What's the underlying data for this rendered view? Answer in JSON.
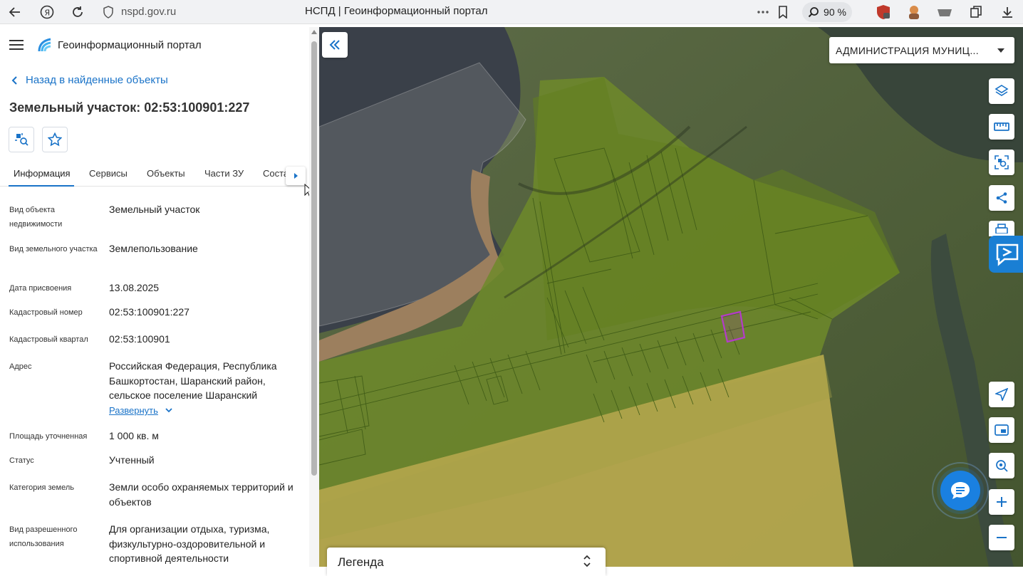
{
  "browser": {
    "url": "nspd.gov.ru",
    "tab_title": "НСПД | Геоинформационный портал",
    "zoom": "90 %"
  },
  "header": {
    "portal_title": "Геоинформационный портал"
  },
  "nav": {
    "back_label": "Назад в найденные объекты"
  },
  "object": {
    "title": "Земельный участок: 02:53:100901:227"
  },
  "tabs": [
    {
      "label": "Информация"
    },
    {
      "label": "Сервисы"
    },
    {
      "label": "Объекты"
    },
    {
      "label": "Части ЗУ"
    },
    {
      "label": "Соста"
    }
  ],
  "properties": [
    {
      "label": "Вид объекта недвижимости",
      "value": "Земельный участок"
    },
    {
      "label": "Вид земельного участка",
      "value": "Землепользование"
    },
    {
      "label": "Дата присвоения",
      "value": "13.08.2025"
    },
    {
      "label": "Кадастровый номер",
      "value": "02:53:100901:227"
    },
    {
      "label": "Кадастровый квартал",
      "value": "02:53:100901"
    },
    {
      "label": "Адрес",
      "value": "Российская Федерация, Республика Башкортостан, Шаранский район, сельское поселение Шаранский"
    },
    {
      "label": "Площадь уточненная",
      "value": "1 000 кв. м"
    },
    {
      "label": "Статус",
      "value": "Учтенный"
    },
    {
      "label": "Категория земель",
      "value": "Земли особо охраняемых территорий и объектов"
    },
    {
      "label": "Вид разрешенного использования",
      "value": "Для организации отдыха, туризма, физкультурно-оздоровительной и спортивной деятельности"
    }
  ],
  "expand_label": "Развернуть",
  "map": {
    "layer_select": "АДМИНИСТРАЦИЯ МУНИЦ...",
    "legend_title": "Легенда"
  },
  "icons": {
    "tools": [
      "layers-icon",
      "ruler-icon",
      "select-area-icon",
      "share-icon",
      "print-icon",
      "locate-icon",
      "minimap-icon",
      "geo-search-icon",
      "zoom-in-icon",
      "zoom-out-icon"
    ]
  },
  "colors": {
    "accent": "#1a73c8",
    "selected_parcel": "#b43cc8"
  }
}
